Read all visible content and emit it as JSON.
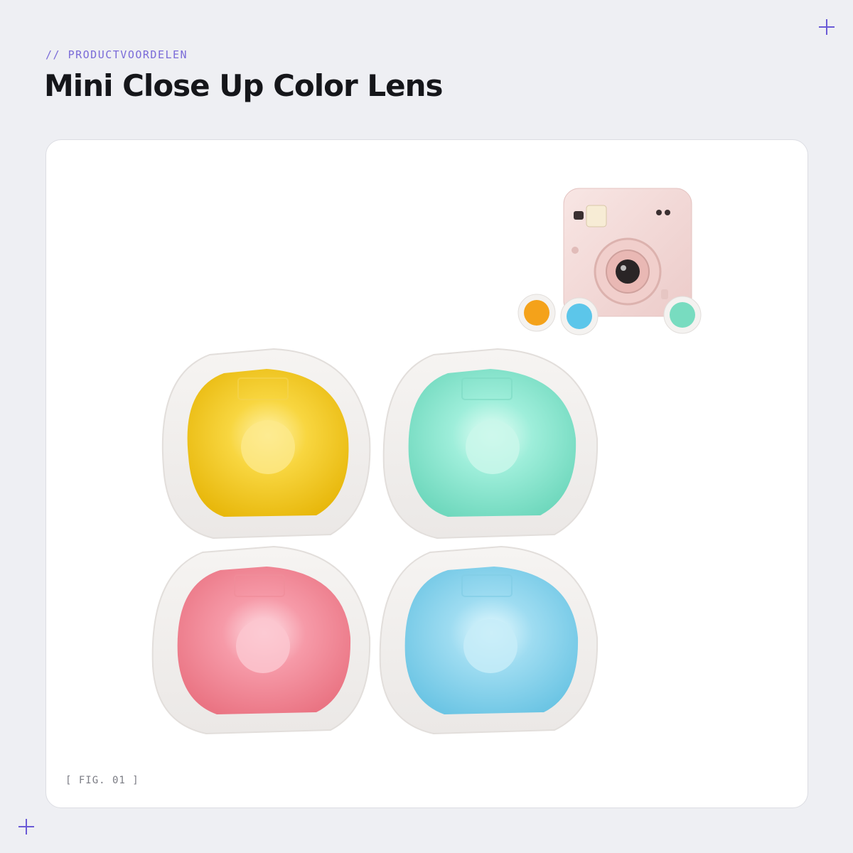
{
  "header": {
    "eyebrow": "// PRODUCTVOORDELEN",
    "title": "Mini Close Up Color Lens"
  },
  "figure": {
    "caption": "[ FIG. 01 ]"
  },
  "colors": {
    "background": "#eeeff3",
    "accent": "#6a5ad6",
    "title": "#15161a",
    "card": "#ffffff",
    "lens_yellow": "#f6cf2a",
    "lens_mint": "#8fe8d0",
    "lens_pink": "#f28f9c",
    "lens_blue": "#8fd6ee",
    "camera_body": "#f4d9d8"
  },
  "icons": [
    "plus-icon",
    "plus-icon"
  ]
}
